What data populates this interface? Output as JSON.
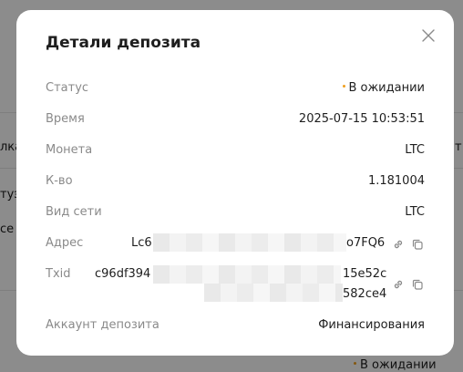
{
  "background": {
    "left_fragments": [
      "лка",
      "туэ",
      "ce"
    ],
    "bottom_status": "В ожидании",
    "right_fragment": "т"
  },
  "modal": {
    "title": "Детали депозита",
    "rows": {
      "status": {
        "label": "Статус",
        "value": "В ожидании"
      },
      "time": {
        "label": "Время",
        "value": "2025-07-15 10:53:51"
      },
      "coin": {
        "label": "Монета",
        "value": "LTC"
      },
      "amount": {
        "label": "К-во",
        "value": "1.181004"
      },
      "network": {
        "label": "Вид сети",
        "value": "LTC"
      },
      "address": {
        "label": "Адрес",
        "value_start": "Lc6",
        "value_end": "o7FQ6"
      },
      "txid": {
        "label": "Txid",
        "value_start": "c96df394",
        "value_end_line1": "15e52c",
        "value_end_line2": "582ce4"
      },
      "account": {
        "label": "Аккаунт депозита",
        "value": "Финансирования"
      }
    }
  },
  "icons": {
    "close": "close-icon",
    "link": "link-icon",
    "copy": "copy-icon"
  },
  "colors": {
    "pending_dot": "#f0a020",
    "label": "#8a8a8a",
    "text": "#1e1e1e"
  }
}
